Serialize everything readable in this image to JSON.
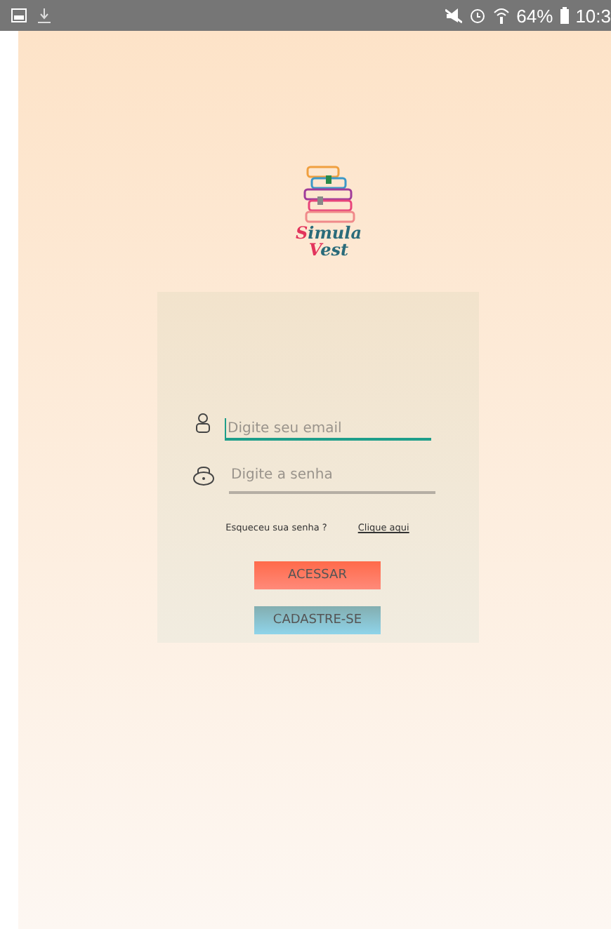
{
  "status_bar": {
    "battery": "64%",
    "time": "10:3"
  },
  "logo": {
    "line_1": "Simula",
    "line_2": "Vest"
  },
  "login_form": {
    "fields": [
      {
        "kind": "email",
        "placeholder": "Digite seu email",
        "focused": true
      },
      {
        "kind": "password",
        "placeholder": "Digite a senha",
        "focused": false
      }
    ],
    "forgot_text": "Esqueceu sua senha ?",
    "forgot_link": "Clique aqui",
    "buttons": [
      {
        "kind": "primary",
        "label": "ACESSAR"
      },
      {
        "kind": "secondary",
        "label": "CADASTRE-SE"
      }
    ]
  }
}
